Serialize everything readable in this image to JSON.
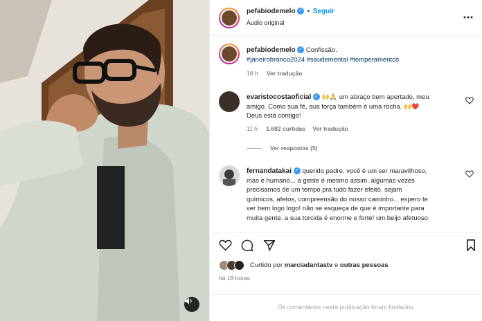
{
  "header": {
    "username": "pefabiodemelo",
    "separator": "•",
    "follow_label": "Seguir",
    "subtitle": "Áudio original"
  },
  "caption": {
    "username": "pefabiodemelo",
    "text": "Confissão.",
    "hashtags": "#janeirobranco2024 #saudemental #temperamentos",
    "time": "18 h",
    "translate": "Ver tradução"
  },
  "comments": [
    {
      "username": "evaristocostaoficial",
      "emoji_lead": "🙌🙏",
      "text_line1": "um abraço bem apertado, meu",
      "text_line2": "amigo. Como sua fé, sua força também é uma rocha.",
      "emoji_tail": "🙌❤️",
      "text_line3": "Deus está contigo!",
      "time": "11 h",
      "likes": "1.682 curtidas",
      "translate": "Ver tradução",
      "replies": "Ver respostas (5)"
    },
    {
      "username": "fernandatakai",
      "lines": [
        "querido padre, você é um ser maravilhoso,",
        "mas é humano... a gente é mesmo assim. algumas vezes",
        "precisamos de um tempo pra tudo fazer efeito. sejam",
        "químicos, afetos, compreensão do nosso caminho... espero te",
        "ver bem logo logo! não se esqueça de que é importante para",
        "muita gente. a sua torcida é enorme e forte! um beijo afetuoso"
      ]
    }
  ],
  "likes_row": {
    "prefix": "Curtido por",
    "user": "marciadantastv",
    "connector": "e",
    "others": "outras pessoas"
  },
  "post_time": "há 18 horas",
  "limited_notice": "Os comentários nesta publicação foram limitados.",
  "icons": {
    "like": "heart-icon",
    "comment": "comment-icon",
    "share": "share-icon",
    "save": "bookmark-icon",
    "audio": "speaker-icon"
  },
  "colors": {
    "link": "#00376b",
    "follow": "#0095f6",
    "muted": "#737373",
    "verified": "#3897f0"
  }
}
